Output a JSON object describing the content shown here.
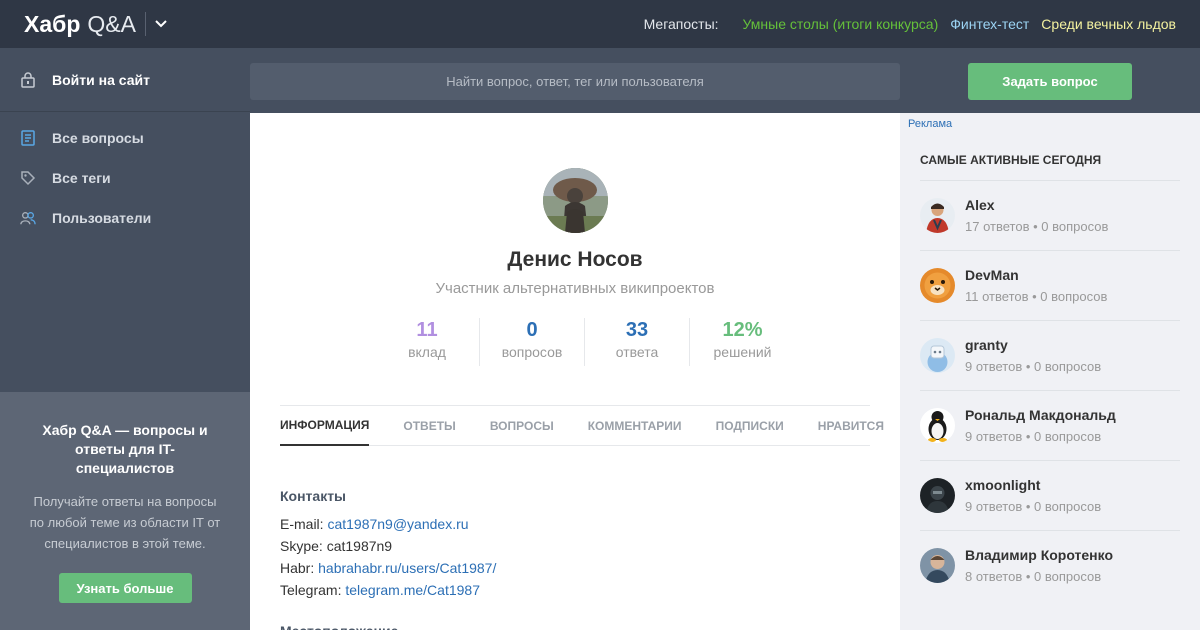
{
  "header": {
    "logo_main": "Хабр",
    "logo_sub": "Q&A",
    "megaposts_label": "Мегапосты:",
    "megaposts": [
      "Умные столы (итоги конкурса)",
      "Финтех-тест",
      "Среди вечных льдов"
    ]
  },
  "sidebar": {
    "login": "Войти на сайт",
    "nav": [
      "Все вопросы",
      "Все теги",
      "Пользователи"
    ],
    "promo_title": "Хабр Q&A — вопросы и ответы для IT-специалистов",
    "promo_text": "Получайте ответы на вопросы по любой теме из области IT от специалистов в этой теме.",
    "promo_button": "Узнать больше"
  },
  "search": {
    "placeholder": "Найти вопрос, ответ, тег или пользователя"
  },
  "ask_button": "Задать вопрос",
  "profile": {
    "name": "Денис Носов",
    "role": "Участник альтернативных википроектов",
    "stats": [
      {
        "value": "11",
        "label": "вклад"
      },
      {
        "value": "0",
        "label": "вопросов"
      },
      {
        "value": "33",
        "label": "ответа"
      },
      {
        "value": "12%",
        "label": "решений"
      }
    ],
    "tabs": [
      "ИНФОРМАЦИЯ",
      "ОТВЕТЫ",
      "ВОПРОСЫ",
      "КОММЕНТАРИИ",
      "ПОДПИСКИ",
      "НРАВИТСЯ"
    ],
    "contacts_title": "Контакты",
    "contacts": [
      {
        "label": "E-mail:",
        "value": "cat1987n9@yandex.ru"
      },
      {
        "label": "Skype:",
        "value": "cat1987n9"
      },
      {
        "label": "Habr:",
        "value": "habrahabr.ru/users/Cat1987/"
      },
      {
        "label": "Telegram:",
        "value": "telegram.me/Cat1987"
      }
    ],
    "location_title": "Местоположение"
  },
  "right": {
    "ad": "Реклама",
    "active_title": "САМЫЕ АКТИВНЫЕ СЕГОДНЯ",
    "users": [
      {
        "name": "Alex",
        "meta": "17 ответов • 0 вопросов"
      },
      {
        "name": "DevMan",
        "meta": "11 ответов • 0 вопросов"
      },
      {
        "name": "granty",
        "meta": "9 ответов • 0 вопросов"
      },
      {
        "name": "Рональд Макдональд",
        "meta": "9 ответов • 0 вопросов"
      },
      {
        "name": "xmoonlight",
        "meta": "9 ответов • 0 вопросов"
      },
      {
        "name": "Владимир Коротенко",
        "meta": "8 ответов • 0 вопросов"
      }
    ]
  },
  "colors": {
    "topbar": "#2f3745",
    "sidebar": "#454f5f",
    "accent_green": "#67bd7c",
    "link_blue": "#2c6fb5"
  }
}
